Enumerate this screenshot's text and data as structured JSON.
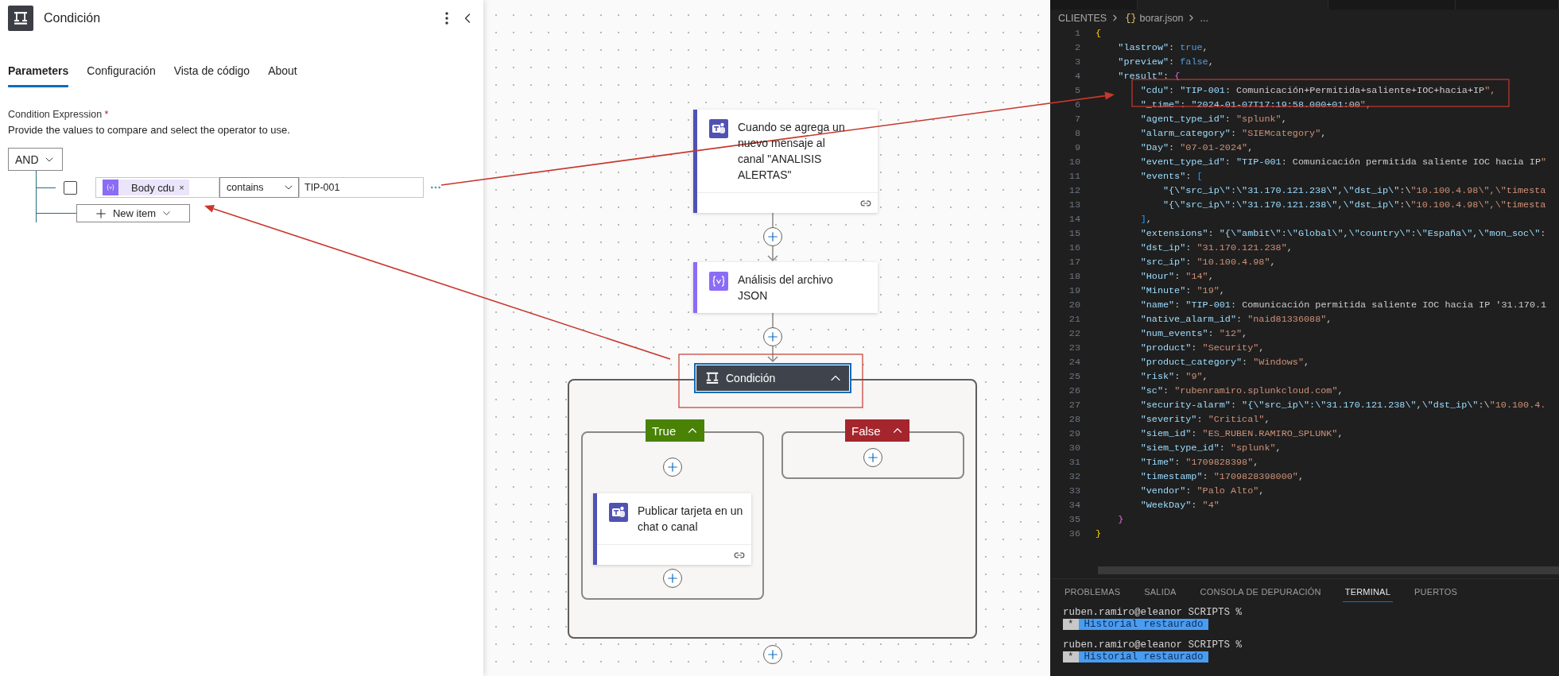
{
  "panel": {
    "title": "Condición",
    "tabs": [
      {
        "label": "Parameters",
        "selected": true
      },
      {
        "label": "Configuración",
        "selected": false
      },
      {
        "label": "Vista de código",
        "selected": false
      },
      {
        "label": "About",
        "selected": false
      }
    ],
    "field_label": "Condition Expression",
    "required_mark": "*",
    "description": "Provide the values to compare and select the operator to use.",
    "group_operator": "AND",
    "rows": [
      {
        "checked": false,
        "token": "Body cdu",
        "remove": "×",
        "operator": "contains",
        "value": "TIP-001"
      }
    ],
    "new_item": "New item"
  },
  "flow": {
    "steps": [
      {
        "kind": "chat",
        "title": "Cuando se agrega un nuevo mensaje al canal \"ANALISIS ALERTAS\"",
        "color": "#4f52b2"
      },
      {
        "kind": "variable",
        "title": "Análisis del archivo JSON",
        "color": "#8b6cf6"
      }
    ],
    "condition": {
      "title": "Condición",
      "expanded": true,
      "branches": [
        {
          "label": "True",
          "color": "#498205",
          "steps": [
            {
              "kind": "chat",
              "title": "Publicar tarjeta en un chat o canal",
              "color": "#4f52b2"
            }
          ]
        },
        {
          "label": "False",
          "color": "#a4262c"
        }
      ]
    }
  },
  "editor": {
    "breadcrumb": {
      "folder": "CLIENTES",
      "file_glyph": "{}",
      "file": "borar.json",
      "more": "..."
    },
    "lines": [
      {
        "number": "1",
        "text": "{"
      },
      {
        "number": "2",
        "text": "    \"lastrow\": true,"
      },
      {
        "number": "3",
        "text": "    \"preview\": false,"
      },
      {
        "number": "4",
        "text": "    \"result\": {"
      },
      {
        "number": "5",
        "text": "        \"cdu\": \"TIP-001: Comunicación+Permitida+saliente+IOC+hacia+IP\","
      },
      {
        "number": "6",
        "text": "        \"_time\": \"2024-01-07T17:19:58.000+01:00\","
      },
      {
        "number": "7",
        "text": "        \"agent_type_id\": \"splunk\","
      },
      {
        "number": "8",
        "text": "        \"alarm_category\": \"SIEMcategory\","
      },
      {
        "number": "9",
        "text": "        \"Day\": \"07-01-2024\","
      },
      {
        "number": "10",
        "text": "        \"event_type_id\": \"TIP-001: Comunicación permitida saliente IOC hacia IP\""
      },
      {
        "number": "11",
        "text": "        \"events\": ["
      },
      {
        "number": "12",
        "text": "            \"{\\\"src_ip\\\":\\\"31.170.121.238\\\",\\\"dst_ip\\\":\\\"10.100.4.98\\\",\\\"timesta"
      },
      {
        "number": "13",
        "text": "            \"{\\\"src_ip\\\":\\\"31.170.121.238\\\",\\\"dst_ip\\\":\\\"10.100.4.98\\\",\\\"timesta"
      },
      {
        "number": "14",
        "text": "        ],"
      },
      {
        "number": "15",
        "text": "        \"extensions\": \"{\\\"ambit\\\":\\\"Global\\\",\\\"country\\\":\\\"España\\\",\\\"mon_soc\\\":"
      },
      {
        "number": "16",
        "text": "        \"dst_ip\": \"31.170.121.238\","
      },
      {
        "number": "17",
        "text": "        \"src_ip\": \"10.100.4.98\","
      },
      {
        "number": "18",
        "text": "        \"Hour\": \"14\","
      },
      {
        "number": "19",
        "text": "        \"Minute\": \"19\","
      },
      {
        "number": "20",
        "text": "        \"name\": \"TIP-001: Comunicación permitida saliente IOC hacia IP '31.170.1"
      },
      {
        "number": "21",
        "text": "        \"native_alarm_id\": \"naid81336088\","
      },
      {
        "number": "22",
        "text": "        \"num_events\": \"12\","
      },
      {
        "number": "23",
        "text": "        \"product\": \"Security\","
      },
      {
        "number": "24",
        "text": "        \"product_category\": \"Windows\","
      },
      {
        "number": "25",
        "text": "        \"risk\": \"9\","
      },
      {
        "number": "26",
        "text": "        \"sc\": \"rubenramiro.splunkcloud.com\","
      },
      {
        "number": "27",
        "text": "        \"security-alarm\": \"{\\\"src_ip\\\":\\\"31.170.121.238\\\",\\\"dst_ip\\\":\\\"10.100.4."
      },
      {
        "number": "28",
        "text": "        \"severity\": \"Critical\","
      },
      {
        "number": "29",
        "text": "        \"siem_id\": \"ES_RUBEN.RAMIRO_SPLUNK\","
      },
      {
        "number": "30",
        "text": "        \"siem_type_id\": \"splunk\","
      },
      {
        "number": "31",
        "text": "        \"Time\": \"1709828398\","
      },
      {
        "number": "32",
        "text": "        \"timestamp\": \"1709828398000\","
      },
      {
        "number": "33",
        "text": "        \"vendor\": \"Palo Alto\","
      },
      {
        "number": "34",
        "text": "        \"WeekDay\": \"4\""
      },
      {
        "number": "35",
        "text": "    }"
      },
      {
        "number": "36",
        "text": "}"
      }
    ]
  },
  "terminal": {
    "tabs": [
      {
        "label": "PROBLEMAS",
        "selected": false
      },
      {
        "label": "SALIDA",
        "selected": false
      },
      {
        "label": "CONSOLA DE DEPURACIÓN",
        "selected": false
      },
      {
        "label": "TERMINAL",
        "selected": true
      },
      {
        "label": "PUERTOS",
        "selected": false
      }
    ],
    "entries": [
      {
        "prompt": "ruben.ramiro@eleanor SCRIPTS %",
        "notice_mark": "*",
        "notice": "Historial restaurado"
      },
      {
        "prompt": "ruben.ramiro@eleanor SCRIPTS %",
        "notice_mark": "*",
        "notice": "Historial restaurado"
      }
    ]
  }
}
